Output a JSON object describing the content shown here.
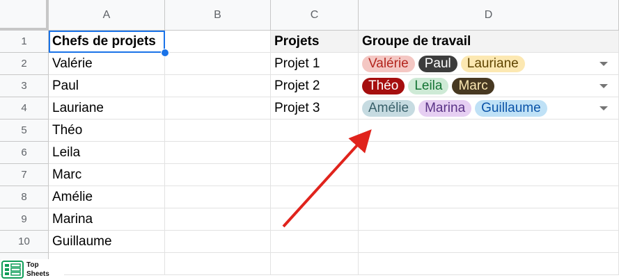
{
  "columns": [
    "A",
    "B",
    "C",
    "D"
  ],
  "rows": [
    "1",
    "2",
    "3",
    "4",
    "5",
    "6",
    "7",
    "8",
    "9",
    "10"
  ],
  "col_a": [
    "Chefs de projets",
    "Valérie",
    "Paul",
    "Lauriane",
    "Théo",
    "Leila",
    "Marc",
    "Amélie",
    "Marina",
    "Guillaume"
  ],
  "col_c": [
    "Projets",
    "Projet 1",
    "Projet 2",
    "Projet 3"
  ],
  "col_d_header": "Groupe de travail",
  "groups": [
    [
      {
        "name": "Valérie",
        "bg": "#f4c7c3",
        "fg": "#b3261e"
      },
      {
        "name": "Paul",
        "bg": "#3c3c3c",
        "fg": "#ffffff"
      },
      {
        "name": "Lauriane",
        "bg": "#fce8b2",
        "fg": "#5f4400"
      }
    ],
    [
      {
        "name": "Théo",
        "bg": "#a50e0e",
        "fg": "#ffffff"
      },
      {
        "name": "Leila",
        "bg": "#ceead6",
        "fg": "#137333"
      },
      {
        "name": "Marc",
        "bg": "#473821",
        "fg": "#fce8b2"
      }
    ],
    [
      {
        "name": "Amélie",
        "bg": "#c6dbe1",
        "fg": "#38606a"
      },
      {
        "name": "Marina",
        "bg": "#e6cff2",
        "fg": "#5a3286"
      },
      {
        "name": "Guillaume",
        "bg": "#bfe1f6",
        "fg": "#0a53a8"
      }
    ]
  ],
  "logo": {
    "line1": "Top",
    "line2": "Sheets"
  },
  "colors": {
    "selection": "#1a73e8",
    "arrow": "#e0231c"
  }
}
